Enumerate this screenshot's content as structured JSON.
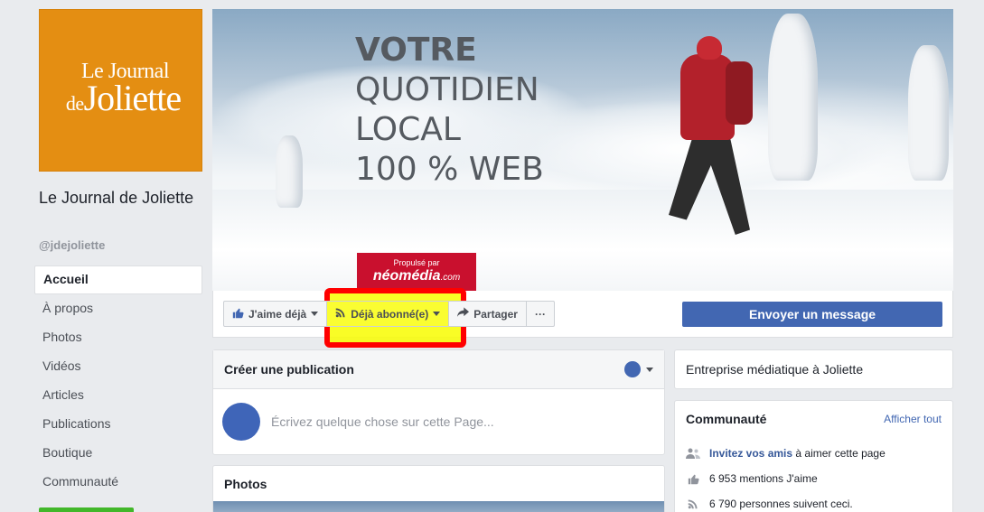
{
  "page": {
    "name": "Le Journal de Joliette",
    "handle": "@jdejoliette",
    "logo": {
      "line1": "Le Journal",
      "line2_prefix": "de",
      "line2_main": "Joliette"
    }
  },
  "sidebar": {
    "items": [
      {
        "label": "Accueil",
        "active": true
      },
      {
        "label": "À propos"
      },
      {
        "label": "Photos"
      },
      {
        "label": "Vidéos"
      },
      {
        "label": "Articles"
      },
      {
        "label": "Publications"
      },
      {
        "label": "Boutique"
      },
      {
        "label": "Communauté"
      }
    ]
  },
  "cover": {
    "headline": "VOTRE",
    "lines": [
      "QUOTIDIEN",
      "LOCAL",
      "100 % WEB"
    ],
    "promo_small": "Propulsé par",
    "promo_brand": "néomédia",
    "promo_suffix": ".com"
  },
  "actions": {
    "like_label": "J'aime déjà",
    "follow_label": "Déjà abonné(e)",
    "share_label": "Partager",
    "more_label": "···",
    "message_label": "Envoyer un message"
  },
  "create_post": {
    "title": "Créer une publication",
    "placeholder": "Écrivez quelque chose sur cette Page..."
  },
  "photos": {
    "title": "Photos"
  },
  "about": {
    "category": "Entreprise médiatique à Joliette"
  },
  "community": {
    "title": "Communauté",
    "see_all": "Afficher tout",
    "invite_link": "Invitez vos amis",
    "invite_rest": " à aimer cette page",
    "likes": "6 953 mentions J'aime",
    "followers": "6 790 personnes suivent ceci."
  },
  "colors": {
    "brand_blue": "#4267b2",
    "logo_orange": "#e48e12",
    "highlight_red": "#ff0000",
    "highlight_yellow": "#f8fd00"
  }
}
